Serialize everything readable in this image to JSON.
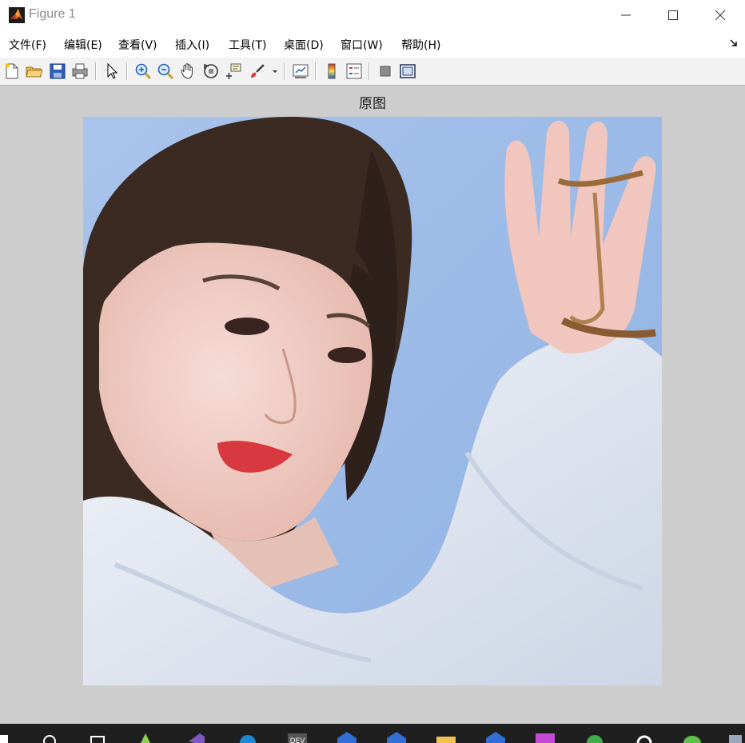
{
  "window": {
    "title": "Figure 1"
  },
  "menu": {
    "items": [
      {
        "label": "文件(F)"
      },
      {
        "label": "编辑(E)"
      },
      {
        "label": "查看(V)"
      },
      {
        "label": "插入(I)"
      },
      {
        "label": "工具(T)"
      },
      {
        "label": "桌面(D)"
      },
      {
        "label": "窗口(W)"
      },
      {
        "label": "帮助(H)"
      }
    ]
  },
  "toolbar": {
    "buttons": [
      "new-figure-icon",
      "open-file-icon",
      "save-icon",
      "print-icon",
      "select-arrow-icon",
      "zoom-in-icon",
      "zoom-out-icon",
      "pan-hand-icon",
      "rotate-3d-icon",
      "data-cursor-icon",
      "brush-icon",
      "link-plot-icon",
      "colorbar-icon",
      "legend-icon",
      "hide-plot-tools-icon",
      "show-plot-tools-icon"
    ]
  },
  "axes": {
    "title": "原图"
  },
  "taskbar": {
    "apps": [
      "start-icon",
      "search-icon",
      "task-view-icon",
      "media-player-icon",
      "visual-studio-icon",
      "edge-icon",
      "dev-cpp-icon",
      "app-blue-icon",
      "app-work-icon",
      "file-explorer-icon",
      "app-work-2-icon",
      "paint-icon",
      "green-app-icon",
      "settings-icon",
      "wechat-icon",
      "app-more-icon"
    ]
  },
  "colors": {
    "sky": "#9dbbe6",
    "robe": "#e8ecf3",
    "hair": "#3a2a22",
    "skin": "#f1cfc8",
    "lips": "#d8383f"
  }
}
